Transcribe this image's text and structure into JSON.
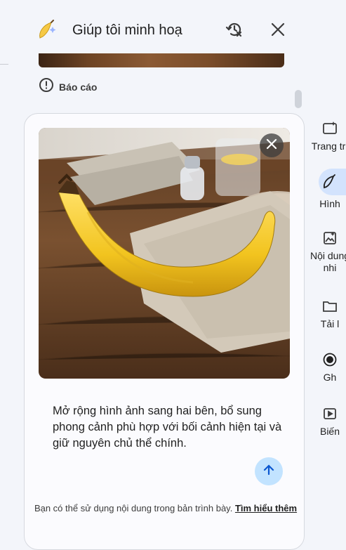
{
  "header": {
    "title": "Giúp tôi minh hoạ",
    "icons": {
      "app": "banana-icon",
      "history": "history-clear-icon",
      "close": "close-icon"
    }
  },
  "report": {
    "label": "Báo cáo",
    "icon": "report-icon"
  },
  "card": {
    "prompt": "Mở rộng hình ảnh sang hai bên, bổ sung phong cảnh phù hợp với bối cảnh hiện tại và giữ nguyên chủ thể chính.",
    "disclaimer_text": "Bạn có thể sử dụng nội dung trong bản trình bày. ",
    "disclaimer_link": "Tìm hiểu thêm"
  },
  "rail": {
    "items": [
      {
        "label": "Trang trí",
        "icon": "slide-sparkle-icon"
      },
      {
        "label": "Hình",
        "icon": "banana-icon",
        "active": true
      },
      {
        "label": "Nội dung\nnhi",
        "icon": "image-icon"
      },
      {
        "label": "Tải l",
        "icon": "folder-icon"
      },
      {
        "label": "Gh",
        "icon": "record-icon"
      },
      {
        "label": "Biến",
        "icon": "video-icon"
      }
    ]
  },
  "colors": {
    "accent_pill": "#d3e3fd",
    "send_button": "#c2e3ff",
    "background": "#f3f5fa"
  }
}
